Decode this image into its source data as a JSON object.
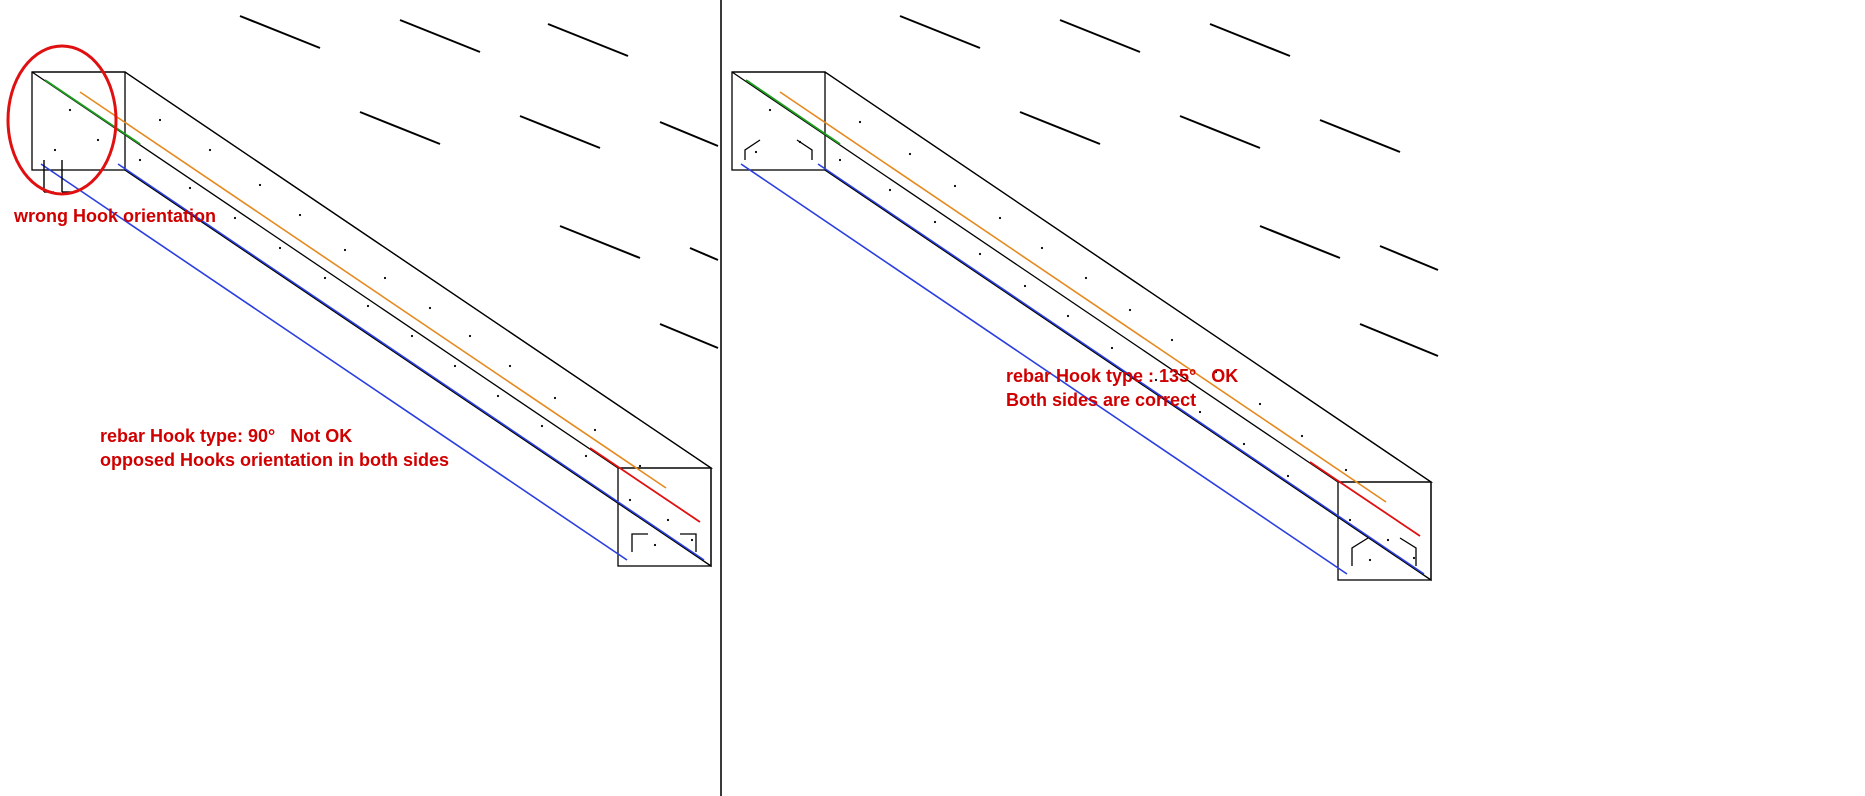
{
  "left_panel": {
    "callout": "wrong Hook orientation",
    "line1": "rebar Hook type: 90°   Not OK",
    "line2": "opposed Hooks orientation in both sides"
  },
  "right_panel": {
    "line1": "rebar Hook type : 135°   OK",
    "line2": "Both sides are correct"
  },
  "chart_data": {
    "type": "diagram",
    "title": "Rebar hook orientation comparison in structural beam (isometric view)",
    "panels": [
      {
        "side": "left",
        "hook_type_deg": 90,
        "status": "Not OK",
        "issue": "opposed hook orientation at both ends; near end shows hooks protruding outside beam cover",
        "annotation_marker": "red ellipse at near (left) end of beam"
      },
      {
        "side": "right",
        "hook_type_deg": 135,
        "status": "OK",
        "issue": "none — both ends correct",
        "annotation_marker": "none"
      }
    ],
    "rebar_colors": {
      "top_longitudinal_near": "green",
      "top_longitudinal_far": "red",
      "longitudinal_main": "orange",
      "stirrups": "blue",
      "beam_outline": "black"
    }
  }
}
